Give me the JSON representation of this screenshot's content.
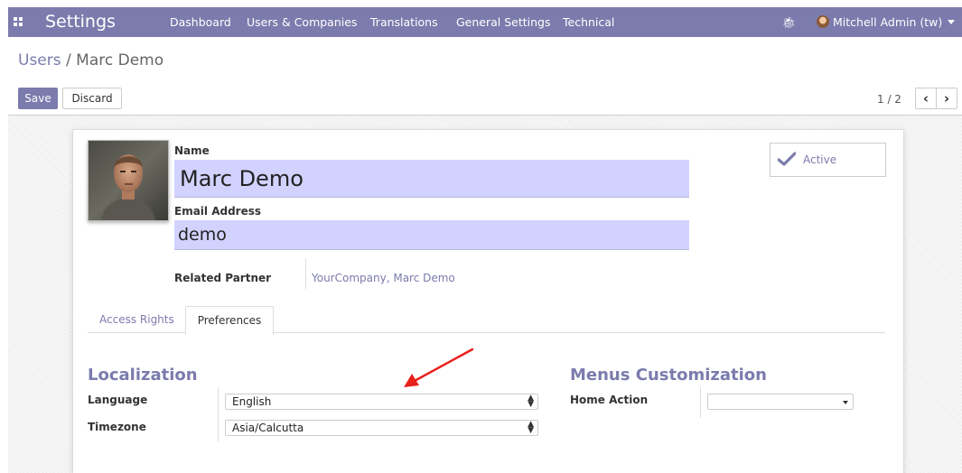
{
  "app": {
    "title": "Settings"
  },
  "nav": {
    "menus": [
      "Dashboard",
      "Users & Companies",
      "Translations",
      "General Settings",
      "Technical"
    ],
    "user": "Mitchell Admin (tw)"
  },
  "breadcrumb": {
    "root": "Users",
    "separator": "/",
    "current": "Marc Demo"
  },
  "buttons": {
    "save": "Save",
    "discard": "Discard"
  },
  "pager": {
    "value": "1 / 2",
    "prev_icon": "chevron-left-icon",
    "next_icon": "chevron-right-icon"
  },
  "form": {
    "name_label": "Name",
    "name_value": "Marc Demo",
    "email_label": "Email Address",
    "email_value": "demo",
    "related_partner_label": "Related Partner",
    "related_partner_value": "YourCompany, Marc Demo",
    "active_label": "Active"
  },
  "tabs": [
    {
      "label": "Access Rights",
      "active": false
    },
    {
      "label": "Preferences",
      "active": true
    }
  ],
  "preferences": {
    "localization": {
      "title": "Localization",
      "language_label": "Language",
      "language_value": "English",
      "timezone_label": "Timezone",
      "timezone_value": "Asia/Calcutta"
    },
    "menus_customization": {
      "title": "Menus Customization",
      "home_action_label": "Home Action",
      "home_action_value": ""
    }
  },
  "colors": {
    "brand": "#7c7bad",
    "required_field_bg": "#d2d2ff",
    "annotation_arrow": "#e8201c"
  }
}
